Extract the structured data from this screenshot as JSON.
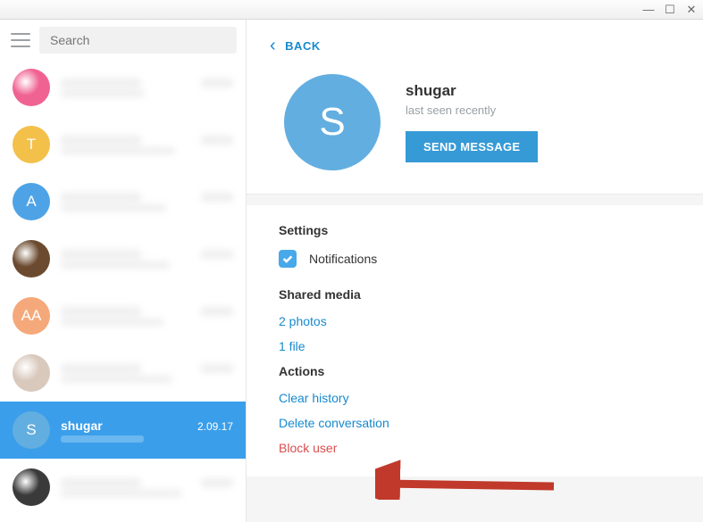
{
  "window": {
    "minimize": "—",
    "maximize": "☐",
    "close": "✕"
  },
  "search": {
    "placeholder": "Search"
  },
  "chats": [
    {
      "initial": "",
      "name": "",
      "msg": "",
      "date": "",
      "avatar_type": "image",
      "color": "#f06292"
    },
    {
      "initial": "T",
      "name": "",
      "msg": "",
      "date": "",
      "avatar_type": "letter",
      "color": "#f3c04a"
    },
    {
      "initial": "A",
      "name": "",
      "msg": "",
      "date": "",
      "avatar_type": "letter",
      "color": "#4ea3e6"
    },
    {
      "initial": "",
      "name": "",
      "msg": "",
      "date": "",
      "avatar_type": "image",
      "color": "#6b4a2f"
    },
    {
      "initial": "AA",
      "name": "",
      "msg": "",
      "date": "",
      "avatar_type": "letter",
      "color": "#f5a97a"
    },
    {
      "initial": "",
      "name": "",
      "msg": "",
      "date": "",
      "avatar_type": "image",
      "color": "#d9c9bd"
    },
    {
      "initial": "S",
      "name": "shugar",
      "msg": "",
      "date": "2.09.17",
      "avatar_type": "letter",
      "color": "#63aee0",
      "selected": true
    },
    {
      "initial": "",
      "name": "",
      "msg": "",
      "date": "",
      "avatar_type": "image",
      "color": "#3a3a3a"
    }
  ],
  "back_label": "BACK",
  "profile": {
    "initial": "S",
    "name": "shugar",
    "status": "last seen recently",
    "send_button": "SEND MESSAGE"
  },
  "settings": {
    "title": "Settings",
    "notifications": "Notifications"
  },
  "shared": {
    "title": "Shared media",
    "photos": "2 photos",
    "files": "1 file"
  },
  "actions": {
    "title": "Actions",
    "clear": "Clear history",
    "delete": "Delete conversation",
    "block": "Block user"
  },
  "colors": {
    "accent": "#168acd",
    "danger": "#d94d4d",
    "selected": "#3a9eea"
  }
}
